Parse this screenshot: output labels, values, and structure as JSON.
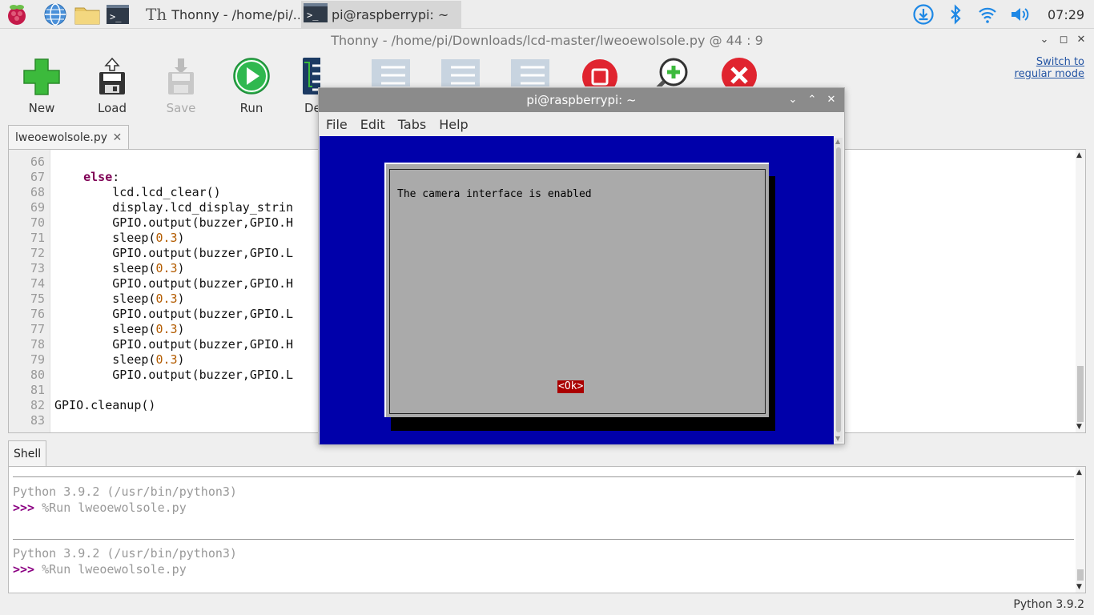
{
  "taskbar": {
    "tasks": [
      {
        "label": "Thonny  -  /home/pi/..."
      },
      {
        "label": "pi@raspberrypi: ~"
      }
    ],
    "clock": "07:29"
  },
  "thonny": {
    "title": "Thonny  -  /home/pi/Downloads/lcd-master/lweoewolsole.py  @  44 : 9",
    "toolbar": [
      {
        "label": "New",
        "icon": "new-icon"
      },
      {
        "label": "Load",
        "icon": "load-icon"
      },
      {
        "label": "Save",
        "icon": "save-icon"
      },
      {
        "label": "Run",
        "icon": "run-icon"
      },
      {
        "label": "De",
        "icon": "debug-icon"
      }
    ],
    "switch_mode": "Switch to regular mode",
    "editor_tab": "lweoewolsole.py",
    "editor_tab_close": "✕",
    "line_numbers": [
      "66",
      "67",
      "68",
      "69",
      "70",
      "71",
      "72",
      "73",
      "74",
      "75",
      "76",
      "77",
      "78",
      "79",
      "80",
      "81",
      "82",
      "83"
    ],
    "code_lines": [
      {
        "indent": "",
        "kw": "",
        "text": "",
        "num": "",
        "end": ""
      },
      {
        "indent": "    ",
        "kw": "else",
        "text": ":",
        "num": "",
        "end": ""
      },
      {
        "indent": "        ",
        "kw": "",
        "text": "lcd.lcd_clear()",
        "num": "",
        "end": ""
      },
      {
        "indent": "        ",
        "kw": "",
        "text": "display.lcd_display_strin",
        "num": "",
        "end": ""
      },
      {
        "indent": "        ",
        "kw": "",
        "text": "GPIO.output(buzzer,GPIO.H",
        "num": "",
        "end": ""
      },
      {
        "indent": "        ",
        "kw": "",
        "text": "sleep(",
        "num": "0.3",
        "end": ")"
      },
      {
        "indent": "        ",
        "kw": "",
        "text": "GPIO.output(buzzer,GPIO.L",
        "num": "",
        "end": ""
      },
      {
        "indent": "        ",
        "kw": "",
        "text": "sleep(",
        "num": "0.3",
        "end": ")"
      },
      {
        "indent": "        ",
        "kw": "",
        "text": "GPIO.output(buzzer,GPIO.H",
        "num": "",
        "end": ""
      },
      {
        "indent": "        ",
        "kw": "",
        "text": "sleep(",
        "num": "0.3",
        "end": ")"
      },
      {
        "indent": "        ",
        "kw": "",
        "text": "GPIO.output(buzzer,GPIO.L",
        "num": "",
        "end": ""
      },
      {
        "indent": "        ",
        "kw": "",
        "text": "sleep(",
        "num": "0.3",
        "end": ")"
      },
      {
        "indent": "        ",
        "kw": "",
        "text": "GPIO.output(buzzer,GPIO.H",
        "num": "",
        "end": ""
      },
      {
        "indent": "        ",
        "kw": "",
        "text": "sleep(",
        "num": "0.3",
        "end": ")"
      },
      {
        "indent": "        ",
        "kw": "",
        "text": "GPIO.output(buzzer,GPIO.L",
        "num": "",
        "end": ""
      },
      {
        "indent": "",
        "kw": "",
        "text": "",
        "num": "",
        "end": ""
      },
      {
        "indent": "",
        "kw": "",
        "text": "GPIO.cleanup()",
        "num": "",
        "end": ""
      },
      {
        "indent": "",
        "kw": "",
        "text": "",
        "num": "",
        "end": ""
      }
    ],
    "shell_tab": "Shell",
    "shell_blocks": [
      {
        "banner": "Python 3.9.2 (/usr/bin/python3)",
        "prompt": ">>>",
        "command": " %Run lweoewolsole.py"
      },
      {
        "banner": "Python 3.9.2 (/usr/bin/python3)",
        "prompt": ">>>",
        "command": " %Run lweoewolsole.py"
      }
    ],
    "status": "Python 3.9.2"
  },
  "terminal": {
    "title": "pi@raspberrypi: ~",
    "menu": [
      "File",
      "Edit",
      "Tabs",
      "Help"
    ],
    "dialog_message": "The camera interface is enabled",
    "ok_label": "<Ok>",
    "colors": {
      "background": "#0000aa",
      "dialog": "#aaaaaa",
      "ok": "#aa0000"
    }
  }
}
